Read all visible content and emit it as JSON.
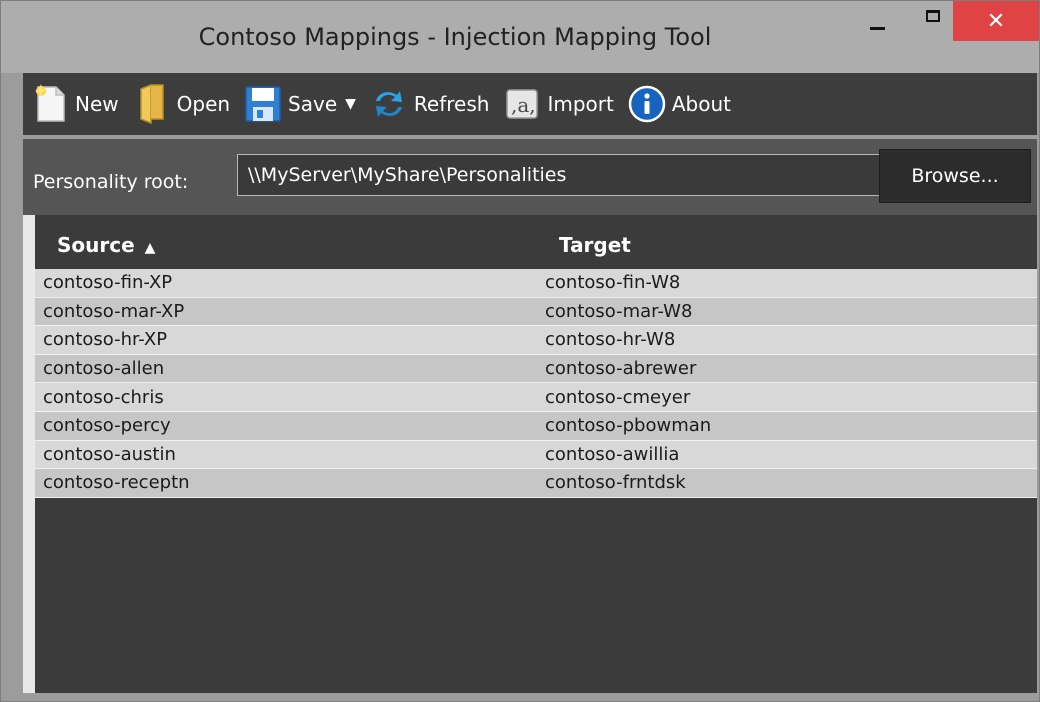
{
  "window": {
    "title": "Contoso Mappings - Injection Mapping Tool",
    "close_glyph": "✕"
  },
  "toolbar": {
    "new_label": "New",
    "open_label": "Open",
    "save_label": "Save",
    "save_caret": "▼",
    "refresh_label": "Refresh",
    "import_label": "Import",
    "about_label": "About"
  },
  "path": {
    "label": "Personality root:",
    "value": "\\\\MyServer\\MyShare\\Personalities",
    "browse_label": "Browse..."
  },
  "grid": {
    "columns": [
      "Source",
      "Target"
    ],
    "sort_indicator": "▲",
    "rows": [
      {
        "source": "contoso-fin-XP",
        "target": "contoso-fin-W8"
      },
      {
        "source": "contoso-mar-XP",
        "target": "contoso-mar-W8"
      },
      {
        "source": "contoso-hr-XP",
        "target": "contoso-hr-W8"
      },
      {
        "source": "contoso-allen",
        "target": "contoso-abrewer"
      },
      {
        "source": "contoso-chris",
        "target": "contoso-cmeyer"
      },
      {
        "source": "contoso-percy",
        "target": "contoso-pbowman"
      },
      {
        "source": "contoso-austin",
        "target": "contoso-awillia"
      },
      {
        "source": "contoso-receptn",
        "target": "contoso-frntdsk"
      }
    ]
  },
  "colors": {
    "titlebar": "#adadad",
    "toolbar": "#3d3d3d",
    "close_button": "#e04343",
    "row_light": "#d8d8d8",
    "row_dark": "#c6c6c6"
  },
  "icons": {
    "new": "new-document-icon",
    "open": "folder-icon",
    "save": "floppy-disk-icon",
    "refresh": "refresh-arrows-icon",
    "import": "import-text-icon",
    "about": "info-icon"
  }
}
